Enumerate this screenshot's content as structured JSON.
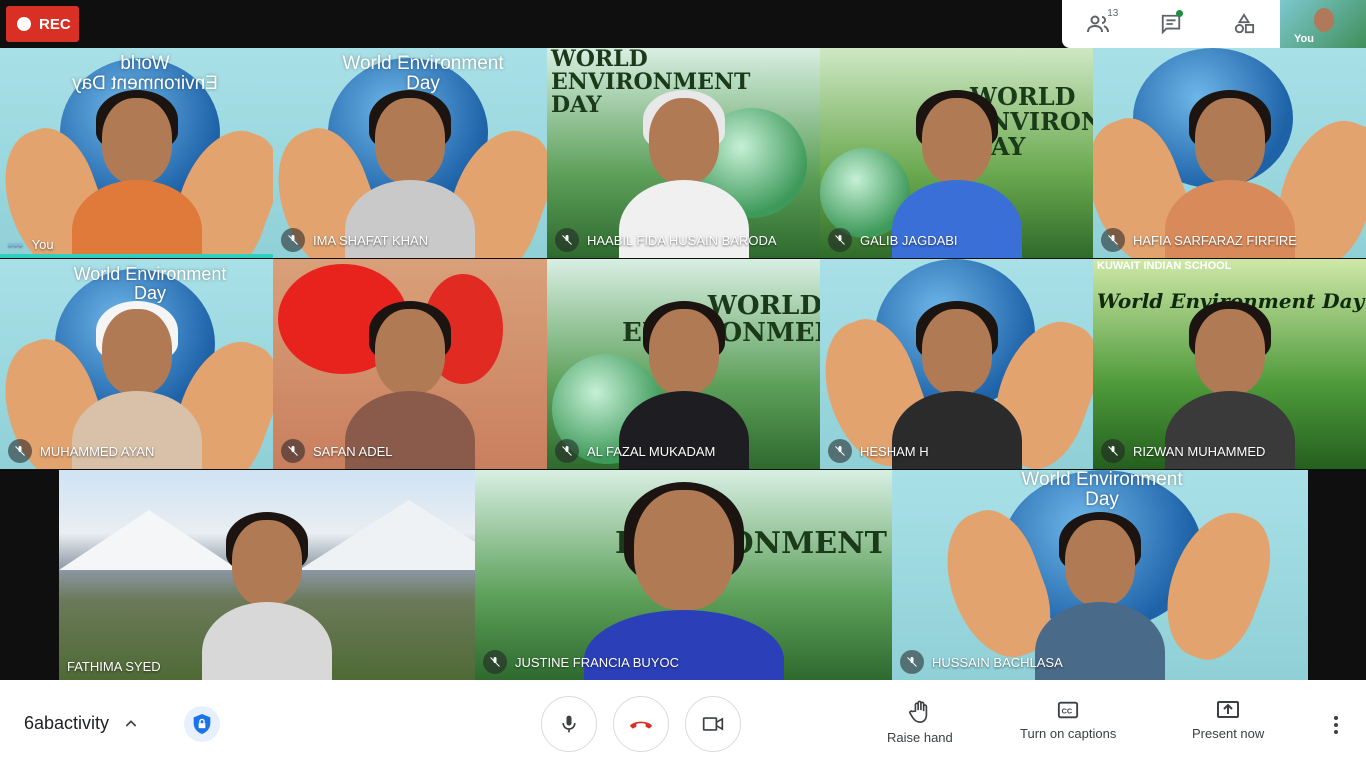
{
  "recording": {
    "label": "REC"
  },
  "top_panel": {
    "participants_count": "13",
    "self_label": "You"
  },
  "tiles": [
    {
      "name": "You",
      "title": "World Environment Day"
    },
    {
      "name": "IMA SHAFAT KHAN",
      "title": "World Environment Day"
    },
    {
      "name": "HAABIL FIDA HUSAIN BARODA",
      "title": "WORLD ENVIRONMENT DAY"
    },
    {
      "name": "GALIB JAGDABI",
      "title": "WORLD ENVIRONMENT DAY"
    },
    {
      "name": "HAFIA SARFARAZ FIRFIRE",
      "title": ""
    },
    {
      "name": "MUHAMMED AYAN",
      "title": "World Environment Day"
    },
    {
      "name": "SAFAN ADEL",
      "title": ""
    },
    {
      "name": "AL FAZAL MUKADAM",
      "title": "WORLD ENVIRONMENT"
    },
    {
      "name": "HESHAM H",
      "title": ""
    },
    {
      "name": "RIZWAN MUHAMMED",
      "title": "World Environment Day",
      "subtitle": "KUWAIT INDIAN SCHOOL"
    },
    {
      "name": "FATHIMA SYED",
      "title": ""
    },
    {
      "name": "JUSTINE FRANCIA BUYOC",
      "title": "ENVIRONMENT"
    },
    {
      "name": "HUSSAIN BACHLASA",
      "title": "World Environment Day"
    }
  ],
  "bottom_bar": {
    "meeting_name": "6abactivity",
    "raise_hand": "Raise hand",
    "captions": "Turn on captions",
    "present": "Present now"
  },
  "colors": {
    "rec": "#d93025",
    "end_call": "#d93025",
    "active_speaker": "#2fd0c0",
    "security": "#1a73e8"
  },
  "icons": [
    "people-icon",
    "chat-icon",
    "activities-icon",
    "mic-icon",
    "end-call-icon",
    "camera-icon",
    "hand-icon",
    "captions-icon",
    "present-icon",
    "more-vert-icon",
    "shield-lock-icon",
    "chevron-up-icon",
    "mic-off-icon"
  ]
}
